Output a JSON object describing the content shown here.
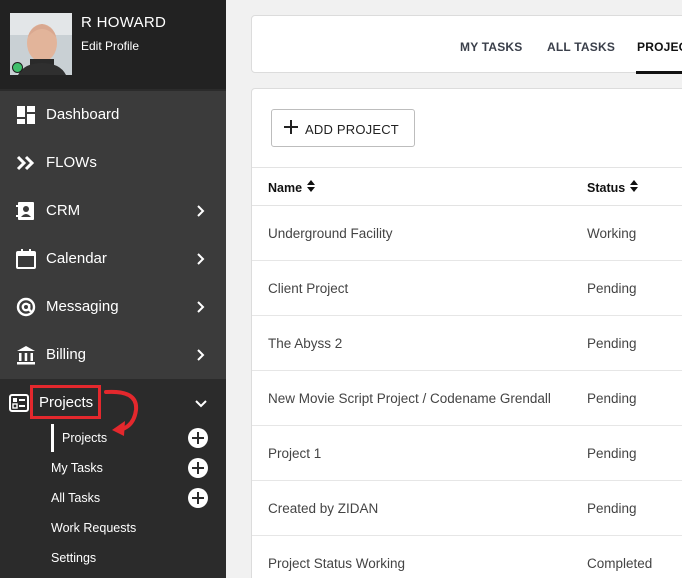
{
  "profile": {
    "name": "R HOWARD",
    "edit_label": "Edit Profile"
  },
  "nav": [
    {
      "label": "Dashboard",
      "icon": "dashboard-icon",
      "chevron": false
    },
    {
      "label": "FLOWs",
      "icon": "double-chevron-icon",
      "chevron": false
    },
    {
      "label": "CRM",
      "icon": "contact-card-icon",
      "chevron": true
    },
    {
      "label": "Calendar",
      "icon": "calendar-icon",
      "chevron": true
    },
    {
      "label": "Messaging",
      "icon": "at-sign-icon",
      "chevron": true
    },
    {
      "label": "Billing",
      "icon": "bank-icon",
      "chevron": true
    },
    {
      "label": "Projects",
      "icon": "checklist-icon",
      "chevron": "down"
    }
  ],
  "projects_submenu": [
    {
      "label": "Projects",
      "has_add": true,
      "current": true
    },
    {
      "label": "My Tasks",
      "has_add": true,
      "current": false
    },
    {
      "label": "All Tasks",
      "has_add": true,
      "current": false
    },
    {
      "label": "Work Requests",
      "has_add": false,
      "current": false
    },
    {
      "label": "Settings",
      "has_add": false,
      "current": false
    }
  ],
  "tabs": [
    {
      "label": "MY TASKS",
      "active": false
    },
    {
      "label": "ALL TASKS",
      "active": false
    },
    {
      "label": "PROJECTS",
      "active": true
    }
  ],
  "add_project_label": "ADD PROJECT",
  "table": {
    "columns": [
      "Name",
      "Status"
    ],
    "rows": [
      {
        "name": "Underground Facility",
        "status": "Working"
      },
      {
        "name": "Client Project",
        "status": "Pending"
      },
      {
        "name": "The Abyss 2",
        "status": "Pending"
      },
      {
        "name": "New Movie Script Project / Codename Grendall",
        "status": "Pending"
      },
      {
        "name": "Project 1",
        "status": "Pending"
      },
      {
        "name": "Created by ZIDAN",
        "status": "Pending"
      },
      {
        "name": "Project Status Working",
        "status": "Completed"
      }
    ]
  },
  "colors": {
    "sidebar_bg": "#2b2b2b",
    "nav_item_bg": "#3b3b3b",
    "highlight_red": "#e4282d",
    "online_green": "#3fbf6b"
  }
}
